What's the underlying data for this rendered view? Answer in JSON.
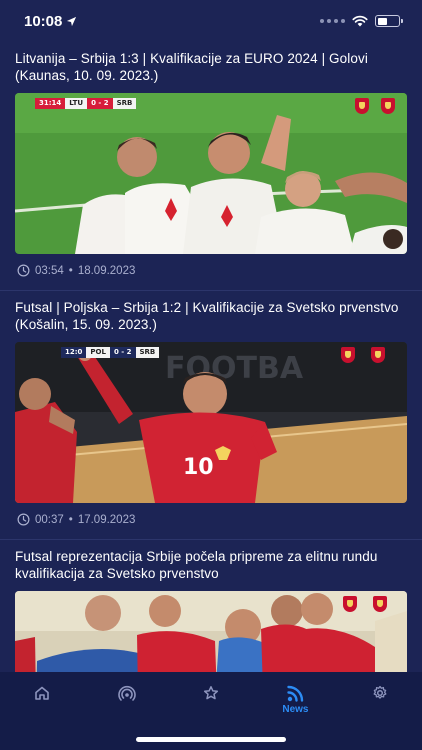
{
  "status": {
    "time": "10:08"
  },
  "articles": [
    {
      "title": "Litvanija – Srbija 1:3 | Kvalifikacije za EURO 2024 | Golovi (Kaunas, 10. 09. 2023.)",
      "duration": "03:54",
      "date": "18.09.2023",
      "score": {
        "clock": "31:14",
        "home": "LTU",
        "result": "0 - 2",
        "away": "SRB"
      }
    },
    {
      "title": "Futsal | Poljska – Srbija 1:2 | Kvalifikacije za Svetsko prvenstvo (Košalin, 15. 09. 2023.)",
      "duration": "00:37",
      "date": "17.09.2023",
      "score": {
        "clock": "12:0",
        "home": "POL",
        "result": "0 - 2",
        "away": "SRB"
      }
    },
    {
      "title": "Futsal reprezentacija Srbije počela pripreme za elitnu rundu kvalifikacija za Svetsko prvenstvo"
    }
  ],
  "meta_separator": "•",
  "tabs": [
    {
      "icon": "home-icon",
      "label": ""
    },
    {
      "icon": "live-broadcast-icon",
      "label": ""
    },
    {
      "icon": "star-icon",
      "label": ""
    },
    {
      "icon": "news-rss-icon",
      "label": "News",
      "active": true
    },
    {
      "icon": "gear-icon",
      "label": ""
    }
  ],
  "colors": {
    "background": "#1c2455",
    "tab_bar": "#141c48",
    "accent": "#2c8cf5",
    "muted": "#aab0cf"
  }
}
